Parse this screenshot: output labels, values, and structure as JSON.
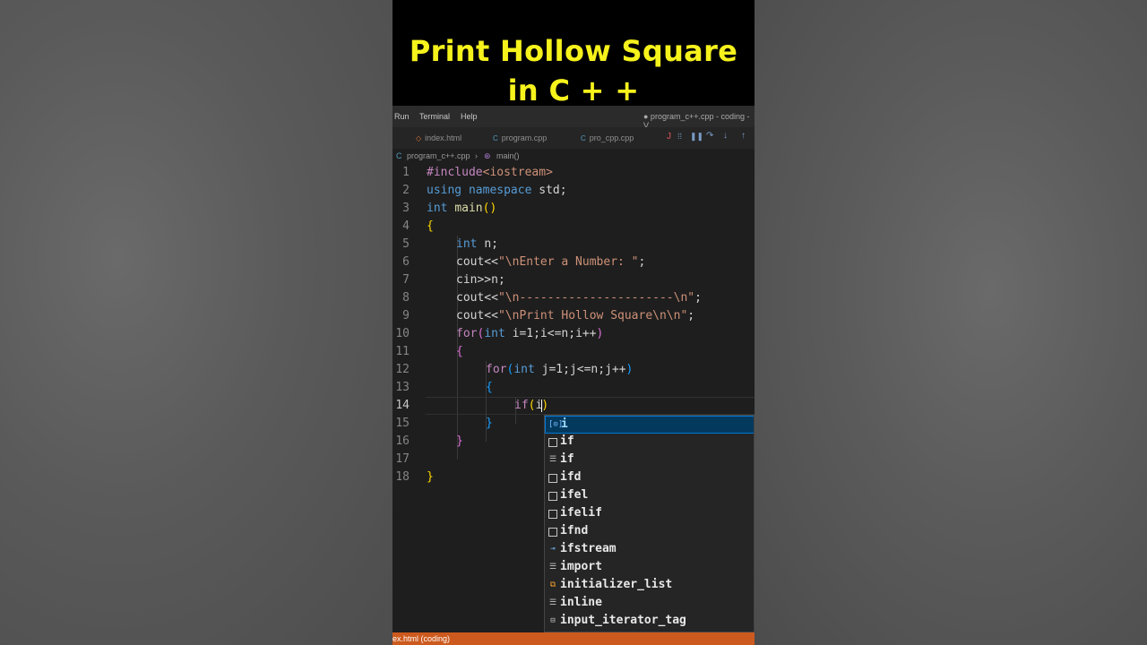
{
  "banner": {
    "line1": "Print Hollow Square",
    "line2": "in C + +"
  },
  "menu": {
    "run": "Run",
    "terminal": "Terminal",
    "help": "Help",
    "window_title": "● program_c++.cpp - coding - V"
  },
  "tabs": [
    {
      "label": "index.html",
      "icon": "html-file-icon"
    },
    {
      "label": "program.cpp",
      "icon": "cpp-file-icon"
    },
    {
      "label": "pro_cpp.cpp",
      "icon": "cpp-file-icon"
    }
  ],
  "debug_toolbar": [
    "pause-icon",
    "restart-icon",
    "step-over-icon",
    "step-into-icon",
    "step-out-icon"
  ],
  "breadcrumb": {
    "file": "program_c++.cpp",
    "symbol": "main()"
  },
  "code": {
    "line_numbers": [
      "1",
      "2",
      "3",
      "4",
      "5",
      "6",
      "7",
      "8",
      "9",
      "10",
      "11",
      "12",
      "13",
      "14",
      "15",
      "16",
      "17",
      "18"
    ],
    "current_line": "14",
    "l1_a": "#include",
    "l1_b": "<iostream>",
    "l2_a": "using",
    "l2_b": "namespace",
    "l2_c": "std;",
    "l3_a": "int",
    "l3_b": "main",
    "l3_c": "()",
    "l4": "{",
    "l5_a": "int",
    "l5_b": "n;",
    "l6_a": "cout<<",
    "l6_b": "\"\\nEnter a Number: \"",
    "l6_c": ";",
    "l7": "cin>>n;",
    "l8_a": "cout<<",
    "l8_b": "\"\\n----------------------\\n\"",
    "l8_c": ";",
    "l9_a": "cout<<",
    "l9_b": "\"\\nPrint Hollow Square\\n\\n\"",
    "l9_c": ";",
    "l10_a": "for",
    "l10_b": "(",
    "l10_c": "int",
    "l10_d": " i=1;i<=n;i++",
    "l10_e": ")",
    "l11": "{",
    "l12_a": "for",
    "l12_b": "(",
    "l12_c": "int",
    "l12_d": " j=1;j<=n;j++",
    "l12_e": ")",
    "l13": "{",
    "l14_a": "if",
    "l14_b": "(",
    "l14_c": "i",
    "l14_d": ")",
    "l15": "}",
    "l16": "}",
    "l18": "}"
  },
  "suggestions": [
    {
      "label": "i",
      "icon": "variable-icon",
      "selected": true
    },
    {
      "label": "if",
      "icon": "snippet-icon"
    },
    {
      "label": "if",
      "icon": "keyword-icon"
    },
    {
      "label": "ifd",
      "icon": "snippet-icon"
    },
    {
      "label": "ifel",
      "icon": "snippet-icon"
    },
    {
      "label": "ifelif",
      "icon": "snippet-icon"
    },
    {
      "label": "ifnd",
      "icon": "snippet-icon"
    },
    {
      "label": "ifstream",
      "icon": "interface-icon"
    },
    {
      "label": "import",
      "icon": "keyword-icon"
    },
    {
      "label": "initializer_list",
      "icon": "class-icon"
    },
    {
      "label": "inline",
      "icon": "keyword-icon"
    },
    {
      "label": "input_iterator_tag",
      "icon": "struct-icon"
    }
  ],
  "status": {
    "text": "ex.html (coding)"
  },
  "colors": {
    "banner_text": "#f6f21c",
    "status_bar": "#cc5a1e",
    "suggest_selected": "#04395e"
  }
}
